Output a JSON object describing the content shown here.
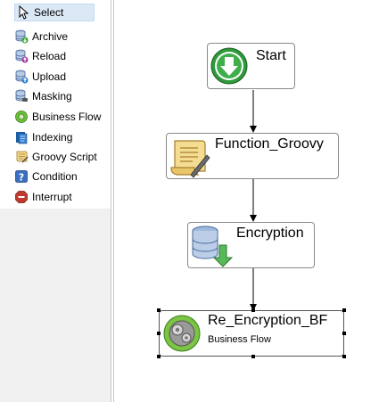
{
  "palette": {
    "items": [
      {
        "label": "Select",
        "icon": "cursor-icon"
      },
      {
        "label": "Archive",
        "icon": "database-archive-icon"
      },
      {
        "label": "Reload",
        "icon": "database-reload-icon"
      },
      {
        "label": "Upload",
        "icon": "database-upload-icon"
      },
      {
        "label": "Masking",
        "icon": "database-masking-icon"
      },
      {
        "label": "Business Flow",
        "icon": "business-flow-icon"
      },
      {
        "label": "Indexing",
        "icon": "indexing-icon"
      },
      {
        "label": "Groovy Script",
        "icon": "groovy-script-icon"
      },
      {
        "label": "Condition",
        "icon": "condition-icon"
      },
      {
        "label": "Interrupt",
        "icon": "interrupt-icon"
      }
    ]
  },
  "flow": {
    "nodes": [
      {
        "title": "Start",
        "icon": "start-arrow-icon"
      },
      {
        "title": "Function_Groovy",
        "icon": "scroll-script-icon"
      },
      {
        "title": "Encryption",
        "icon": "database-encryption-icon"
      },
      {
        "title": "Re_Encryption_BF",
        "subtitle": "Business Flow",
        "icon": "gears-icon"
      }
    ]
  }
}
